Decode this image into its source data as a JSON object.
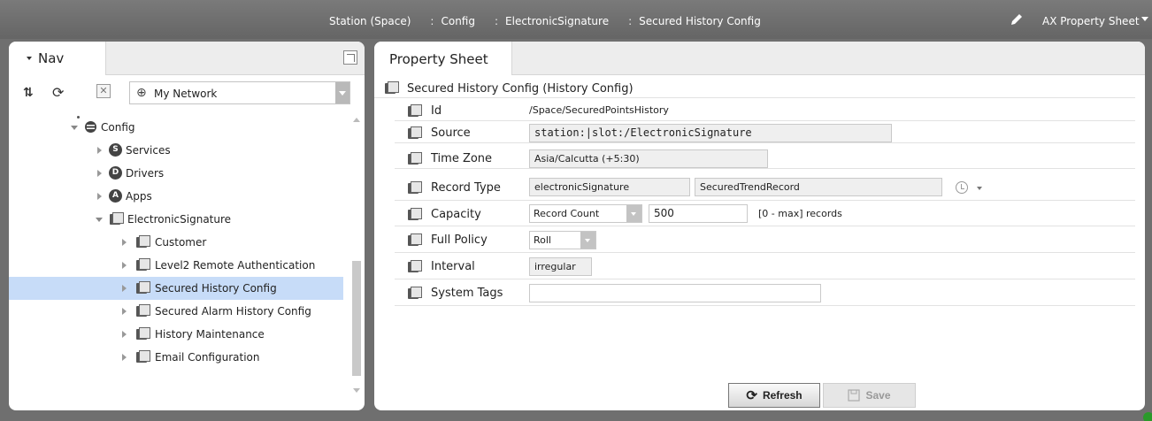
{
  "topbar": {
    "crumbs": [
      "Station (Space)",
      "Config",
      "ElectronicSignature",
      "Secured History Config"
    ],
    "separator": ":",
    "view_name": "AX Property Sheet"
  },
  "nav": {
    "title": "Nav",
    "network_select": "My Network",
    "tree": [
      {
        "label": "Config",
        "level": 1,
        "expanded": true,
        "icon": "database-icon"
      },
      {
        "label": "Services",
        "level": 2,
        "expanded": false,
        "icon": "services-icon"
      },
      {
        "label": "Drivers",
        "level": 2,
        "expanded": false,
        "icon": "drivers-icon"
      },
      {
        "label": "Apps",
        "level": 2,
        "expanded": false,
        "icon": "apps-icon"
      },
      {
        "label": "ElectronicSignature",
        "level": 2,
        "expanded": true,
        "icon": "component-icon"
      },
      {
        "label": "Customer",
        "level": 3,
        "expanded": false,
        "icon": "component-icon"
      },
      {
        "label": "Level2 Remote Authentication",
        "level": 3,
        "expanded": false,
        "icon": "component-icon"
      },
      {
        "label": "Secured History Config",
        "level": 3,
        "expanded": false,
        "icon": "component-icon",
        "selected": true
      },
      {
        "label": "Secured Alarm History Config",
        "level": 3,
        "expanded": false,
        "icon": "component-icon"
      },
      {
        "label": "History Maintenance",
        "level": 3,
        "expanded": false,
        "icon": "component-icon"
      },
      {
        "label": "Email Configuration",
        "level": 3,
        "expanded": false,
        "icon": "component-icon"
      }
    ]
  },
  "property_sheet": {
    "tab_label": "Property Sheet",
    "root_label": "Secured History Config  (History Config)",
    "props": {
      "id": {
        "label": "Id",
        "value": "/Space/SecuredPointsHistory"
      },
      "source": {
        "label": "Source",
        "value": "station:|slot:/ElectronicSignature"
      },
      "time_zone": {
        "label": "Time Zone",
        "value": "Asia/Calcutta (+5:30)"
      },
      "record_type": {
        "label": "Record Type",
        "value1": "electronicSignature",
        "value2": "SecuredTrendRecord"
      },
      "capacity": {
        "label": "Capacity",
        "mode": "Record Count",
        "count": "500",
        "unit": "[0 - max] records"
      },
      "full_policy": {
        "label": "Full Policy",
        "value": "Roll"
      },
      "interval": {
        "label": "Interval",
        "value": "irregular"
      },
      "system_tags": {
        "label": "System Tags",
        "value": ""
      }
    },
    "buttons": {
      "refresh": "Refresh",
      "save": "Save"
    }
  }
}
